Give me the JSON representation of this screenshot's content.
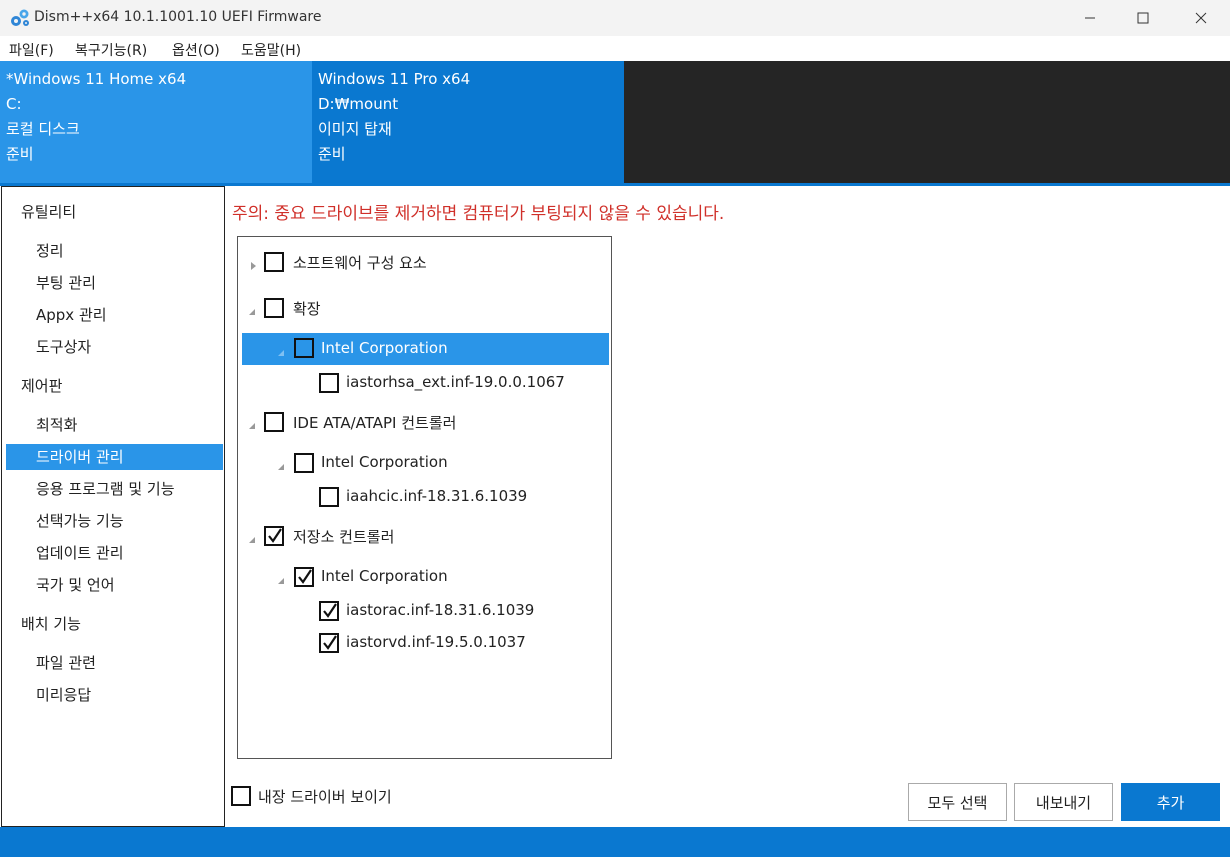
{
  "window": {
    "title": "Dism++x64 10.1.1001.10 UEFI Firmware",
    "app_icon": "gears-icon"
  },
  "menu": [
    "파일(F)",
    "복구기능(R)",
    "옵션(O)",
    "도움말(H)"
  ],
  "sessions": [
    {
      "name": "*Windows 11 Home x64",
      "path": "C:",
      "type": "로컬 디스크",
      "status": "준비"
    },
    {
      "name": "Windows 11 Pro x64",
      "path": "D:₩mount",
      "type": "이미지 탑재",
      "status": "준비"
    }
  ],
  "sidebar": {
    "categories": [
      {
        "label": "유틸리티",
        "items": [
          "정리",
          "부팅 관리",
          "Appx 관리",
          "도구상자"
        ]
      },
      {
        "label": "제어판",
        "items": [
          "최적화",
          "드라이버 관리",
          "응용 프로그램 및 기능",
          "선택가능 기능",
          "업데이트 관리",
          "국가 및 언어"
        ]
      },
      {
        "label": "배치 기능",
        "items": [
          "파일 관련",
          "미리응답"
        ]
      }
    ],
    "selected": "드라이버 관리"
  },
  "main": {
    "warning": "주의: 중요 드라이브를 제거하면 컴퓨터가 부팅되지 않을 수 있습니다.",
    "tree": [
      {
        "label": "소프트웨어 구성 요소",
        "level": 0,
        "expanded": false,
        "checked": false,
        "selected": false
      },
      {
        "label": "확장",
        "level": 0,
        "expanded": true,
        "checked": false,
        "selected": false
      },
      {
        "label": "Intel Corporation",
        "level": 1,
        "expanded": true,
        "checked": false,
        "selected": true
      },
      {
        "label": "iastorhsa_ext.inf-19.0.0.1067",
        "level": 2,
        "checked": false,
        "selected": false
      },
      {
        "label": "IDE ATA/ATAPI 컨트롤러",
        "level": 0,
        "expanded": true,
        "checked": false,
        "selected": false
      },
      {
        "label": "Intel Corporation",
        "level": 1,
        "expanded": true,
        "checked": false,
        "selected": false
      },
      {
        "label": "iaahcic.inf-18.31.6.1039",
        "level": 2,
        "checked": false,
        "selected": false
      },
      {
        "label": "저장소 컨트롤러",
        "level": 0,
        "expanded": true,
        "checked": true,
        "selected": false
      },
      {
        "label": "Intel Corporation",
        "level": 1,
        "expanded": true,
        "checked": true,
        "selected": false
      },
      {
        "label": "iastorac.inf-18.31.6.1039",
        "level": 2,
        "checked": true,
        "selected": false
      },
      {
        "label": "iastorvd.inf-19.5.0.1037",
        "level": 2,
        "checked": true,
        "selected": false
      }
    ],
    "show_builtin_label": "내장 드라이버 보이기",
    "show_builtin_checked": false,
    "buttons": {
      "select_all": "모두 선택",
      "export": "내보내기",
      "add": "추가"
    }
  },
  "colors": {
    "accent": "#0a78d0",
    "accent_light": "#2a95e8",
    "warning": "#d0302a"
  }
}
